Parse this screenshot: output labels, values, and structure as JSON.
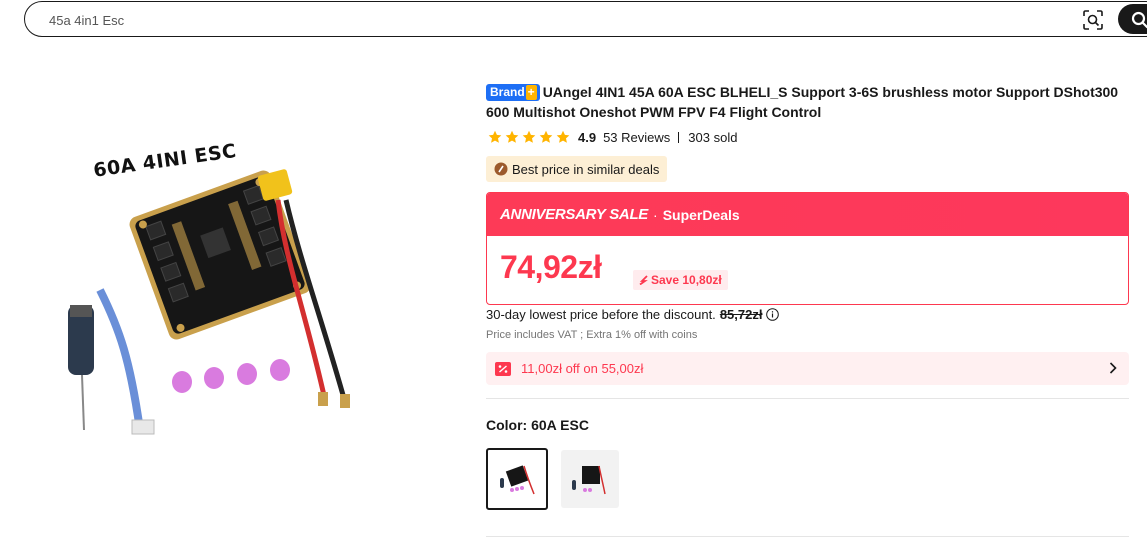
{
  "search": {
    "value": "45a 4in1 Esc"
  },
  "product": {
    "image_caption": "60A 4INI ESC",
    "brand_badge": "Brand",
    "brand_badge_plus": "+",
    "title": "UAngel 4IN1 45A 60A ESC BLHELI_S Support 3-6S brushless motor Support DShot300 600 Multishot Oneshot PWM FPV F4 Flight Control",
    "rating": "4.9",
    "stars": 5,
    "reviews": "53 Reviews",
    "sold": "303 sold",
    "best_price_tag": "Best price in similar deals"
  },
  "sale": {
    "name": "ANNIVERSARY SALE",
    "dot": "·",
    "sub": "SuperDeals",
    "price": "74,92zł",
    "save": "Save 10,80zł"
  },
  "lowest": {
    "text": "30-day lowest price before the discount.",
    "price": "85,72zł"
  },
  "vat_note": "Price includes VAT ; Extra 1% off with coins",
  "coupon": {
    "text": "11,00zł off on 55,00zł"
  },
  "color": {
    "label": "Color: 60A ESC"
  },
  "colors": {
    "accent": "#fd384f",
    "brand_badge": "#1e6ff5",
    "star": "#ffb400",
    "best_price_bg": "#fdefd5"
  },
  "icons": [
    "camera-search-icon",
    "search-icon",
    "star-icon",
    "coin-icon",
    "save-arrow-icon",
    "info-icon",
    "coupon-icon",
    "chevron-right-icon"
  ]
}
